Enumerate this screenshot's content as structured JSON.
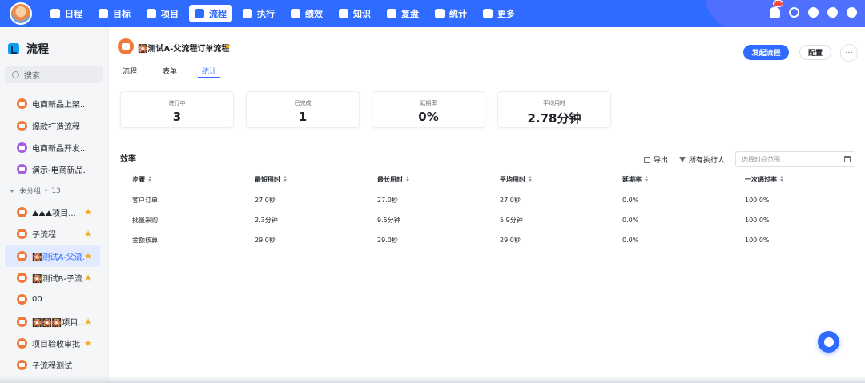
{
  "nav": {
    "items": [
      {
        "label": "日程",
        "icon": "calendar-icon"
      },
      {
        "label": "目标",
        "icon": "target-icon"
      },
      {
        "label": "项目",
        "icon": "project-icon"
      },
      {
        "label": "流程",
        "icon": "flow-icon"
      },
      {
        "label": "执行",
        "icon": "execute-icon"
      },
      {
        "label": "绩效",
        "icon": "performance-icon"
      },
      {
        "label": "知识",
        "icon": "book-icon"
      },
      {
        "label": "复盘",
        "icon": "review-icon"
      },
      {
        "label": "统计",
        "icon": "stats-icon"
      },
      {
        "label": "更多",
        "icon": "grid-icon"
      }
    ],
    "active_index": 3,
    "notification_badge": "•••",
    "accent": "#2f6bff"
  },
  "sidebar": {
    "title": "流程",
    "search_placeholder": "搜索",
    "items_top": [
      {
        "label": "电商新品上架...",
        "color": "#f07a3a"
      },
      {
        "label": "爆款打造流程",
        "color": "#f07a3a"
      },
      {
        "label": "电商新品开发...",
        "color": "#a65ee0"
      },
      {
        "label": "演示-电商新品...",
        "color": "#a65ee0"
      }
    ],
    "group": {
      "label": "未分组",
      "count": "13"
    },
    "items_group": [
      {
        "label": "⛰⛰⛰项目...",
        "color": "#f07a3a",
        "starred": true
      },
      {
        "label": "子流程",
        "color": "#f07a3a",
        "starred": true
      },
      {
        "label": "🎇测试A-父流...",
        "color": "#f07a3a",
        "starred": true,
        "active": true
      },
      {
        "label": "🎇测试B-子流...",
        "color": "#f07a3a",
        "starred": true
      },
      {
        "label": "00",
        "color": "#f07a3a",
        "starred": false
      },
      {
        "label": "🎇🎇🎇项目...",
        "color": "#f07a3a",
        "starred": true
      },
      {
        "label": "项目验收审批",
        "color": "#f07a3a",
        "starred": true
      },
      {
        "label": "子流程测试",
        "color": "#f07a3a",
        "starred": false
      }
    ]
  },
  "header": {
    "title": "🎇测试A-父流程订单流程",
    "primary_button": "发起流程",
    "config_button": "配置",
    "more_button": "···"
  },
  "tabs": [
    {
      "label": "流程"
    },
    {
      "label": "表单"
    },
    {
      "label": "统计"
    }
  ],
  "active_tab": 2,
  "stats": [
    {
      "label": "进行中",
      "value": "3"
    },
    {
      "label": "已完成",
      "value": "1"
    },
    {
      "label": "延期率",
      "value": "0%"
    },
    {
      "label": "平均用时",
      "value": "2.78分钟"
    }
  ],
  "efficiency": {
    "title": "效率",
    "export_label": "导出",
    "assignee_label": "所有执行人",
    "date_placeholder": "选择时间范围",
    "columns": [
      "步骤",
      "最短用时",
      "最长用时",
      "平均用时",
      "延期率",
      "一次通过率"
    ],
    "rows": [
      [
        "客户订单",
        "27.0秒",
        "27.0秒",
        "27.0秒",
        "0.0%",
        "100.0%"
      ],
      [
        "批量采购",
        "2.3分钟",
        "9.5分钟",
        "5.9分钟",
        "0.0%",
        "100.0%"
      ],
      [
        "金额核算",
        "29.0秒",
        "29.0秒",
        "29.0秒",
        "0.0%",
        "100.0%"
      ]
    ]
  }
}
